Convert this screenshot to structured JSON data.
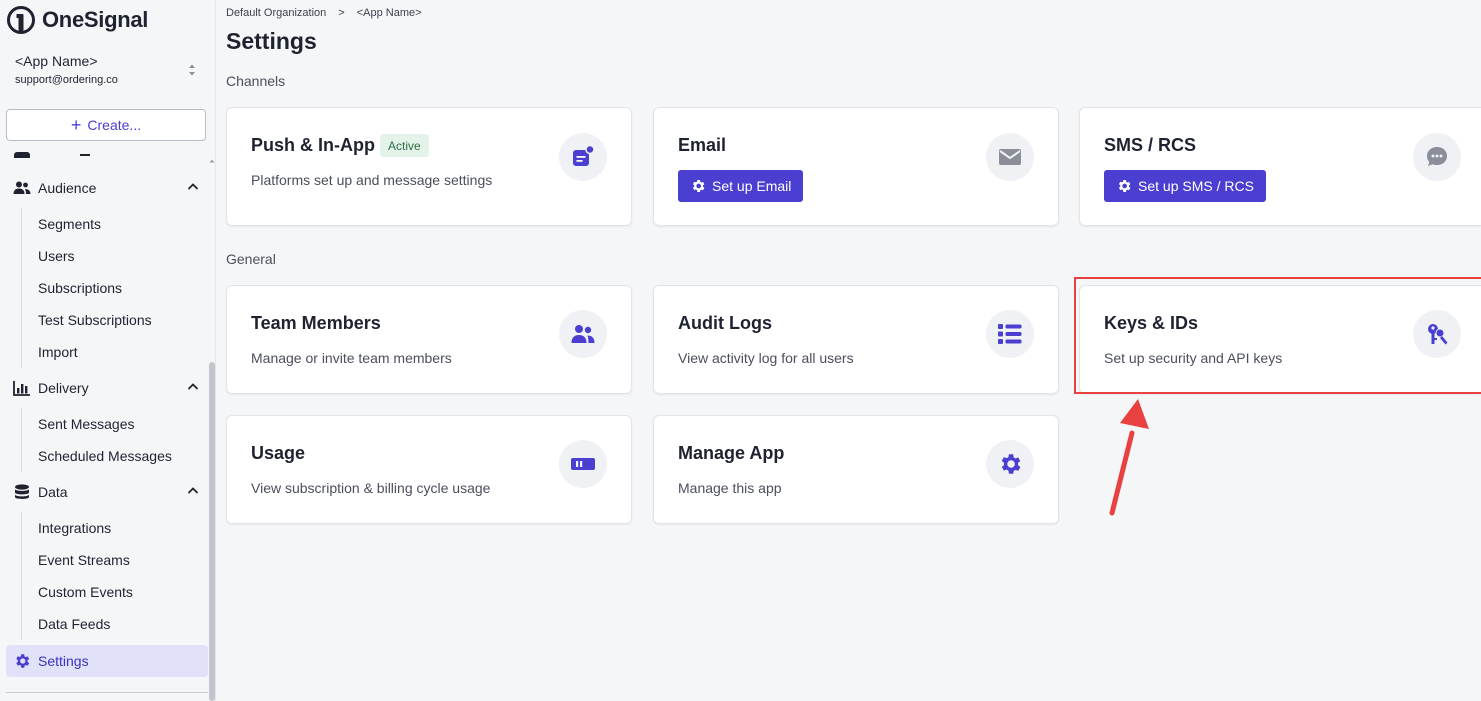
{
  "brand": {
    "name": "OneSignal",
    "accent": "#4a3fd0",
    "highlight_color": "#e8413f"
  },
  "app_switcher": {
    "app_name": "<App Name>",
    "email": "support@ordering.co",
    "icon": "updown-chevron-icon"
  },
  "create_button": {
    "label": "Create...",
    "icon": "plus-icon"
  },
  "sidebar": {
    "groups": [
      {
        "label": "Audience",
        "icon": "users-icon",
        "expanded": true,
        "items": [
          "Segments",
          "Users",
          "Subscriptions",
          "Test Subscriptions",
          "Import"
        ]
      },
      {
        "label": "Delivery",
        "icon": "bar-chart-icon",
        "expanded": true,
        "items": [
          "Sent Messages",
          "Scheduled Messages"
        ]
      },
      {
        "label": "Data",
        "icon": "database-icon",
        "expanded": true,
        "items": [
          "Integrations",
          "Event Streams",
          "Custom Events",
          "Data Feeds"
        ]
      }
    ],
    "active": {
      "label": "Settings",
      "icon": "gear-icon"
    }
  },
  "breadcrumb": {
    "org": "Default Organization",
    "separator": ">",
    "app": "<App Name>"
  },
  "page_title": "Settings",
  "sections": {
    "channels": {
      "label": "Channels",
      "cards": [
        {
          "title": "Push & In-App",
          "badge": "Active",
          "description": "Platforms set up and message settings",
          "icon": "push-notification-icon"
        },
        {
          "title": "Email",
          "button": "Set up Email",
          "icon": "envelope-icon"
        },
        {
          "title": "SMS / RCS",
          "button": "Set up SMS / RCS",
          "icon": "chat-bubble-icon"
        }
      ]
    },
    "general": {
      "label": "General",
      "cards": [
        {
          "title": "Team Members",
          "description": "Manage or invite team members",
          "icon": "team-icon"
        },
        {
          "title": "Audit Logs",
          "description": "View activity log for all users",
          "icon": "list-icon"
        },
        {
          "title": "Keys & IDs",
          "description": "Set up security and API keys",
          "icon": "keys-icon"
        },
        {
          "title": "Usage",
          "description": "View subscription & billing cycle usage",
          "icon": "usage-meter-icon"
        },
        {
          "title": "Manage App",
          "description": "Manage this app",
          "icon": "gear-icon"
        }
      ]
    }
  }
}
